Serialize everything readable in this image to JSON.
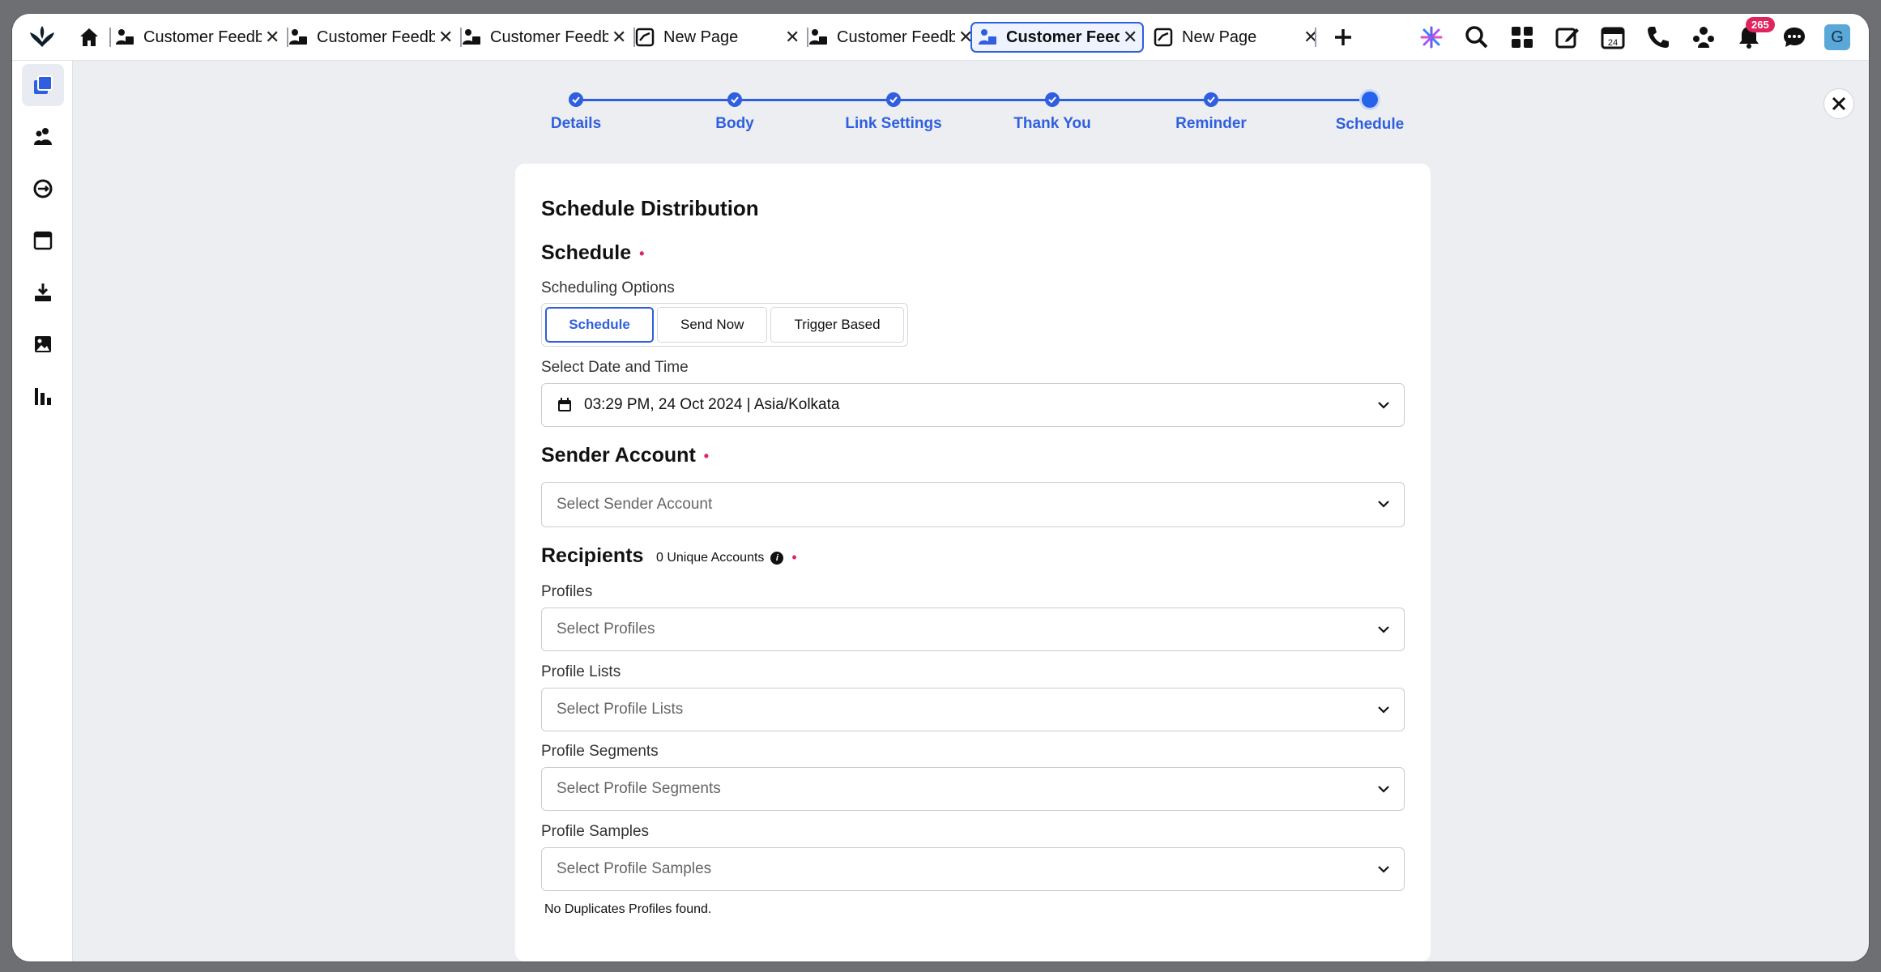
{
  "tabs": [
    {
      "label": "Customer Feedback",
      "icon": "person-tab-icon"
    },
    {
      "label": "Customer Feedback",
      "icon": "person-tab-icon"
    },
    {
      "label": "Customer Feedback",
      "icon": "person-tab-icon"
    },
    {
      "label": "New Page",
      "icon": "page-tab-icon"
    },
    {
      "label": "Customer Feedback",
      "icon": "person-tab-icon"
    },
    {
      "label": "Customer Feedback",
      "icon": "person-tab-icon",
      "active": true
    },
    {
      "label": "New Page",
      "icon": "page-tab-icon"
    }
  ],
  "tab_close_glyph": "✕",
  "notifications": {
    "count": "265"
  },
  "user": {
    "avatar_letter": "G"
  },
  "stepper": {
    "steps": [
      "Details",
      "Body",
      "Link Settings",
      "Thank You",
      "Reminder",
      "Schedule"
    ],
    "current": "Schedule"
  },
  "form": {
    "title": "Schedule Distribution",
    "schedule": {
      "heading": "Schedule",
      "options_label": "Scheduling Options",
      "options": [
        "Schedule",
        "Send Now",
        "Trigger Based"
      ],
      "selected_option": "Schedule",
      "datetime_label": "Select Date and Time",
      "datetime_value": "03:29 PM, 24 Oct 2024 | Asia/Kolkata"
    },
    "sender": {
      "heading": "Sender Account",
      "placeholder": "Select Sender Account"
    },
    "recipients": {
      "heading": "Recipients",
      "unique_accounts": "0 Unique Accounts",
      "fields": [
        {
          "label": "Profiles",
          "placeholder": "Select Profiles"
        },
        {
          "label": "Profile Lists",
          "placeholder": "Select Profile Lists"
        },
        {
          "label": "Profile Segments",
          "placeholder": "Select Profile Segments"
        },
        {
          "label": "Profile Samples",
          "placeholder": "Select Profile Samples"
        }
      ],
      "duplicates_note": "No Duplicates Profiles found."
    },
    "required_marker": "•"
  },
  "colors": {
    "accent": "#2f5fe0",
    "required": "#e0245e",
    "badge": "#e0245e"
  }
}
